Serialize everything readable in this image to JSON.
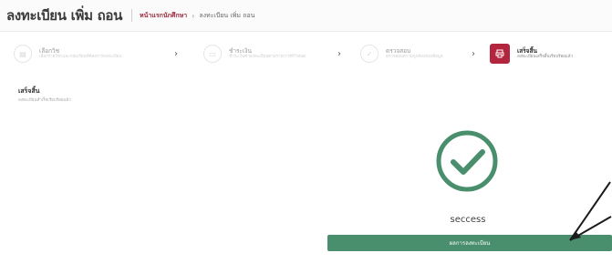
{
  "header": {
    "title": "ลงทะเบียน เพิ่ม ถอน",
    "breadcrumb": {
      "home": "หน้าแรกนักศึกษา",
      "separator": "›",
      "current": "ลงทะเบียน เพิ่ม ถอน"
    }
  },
  "steps": [
    {
      "title": "เลือกวิช",
      "desc": "เลือกรายวิชาและกลุ่มเรียนที่ต้องการลงทะเบียน",
      "icon": "book-icon",
      "active": false
    },
    {
      "title": "ชำระเงิน",
      "desc": "ชำระเงินค่าลงทะเบียนตามรายการที่กำหนด",
      "icon": "wallet-icon",
      "active": false
    },
    {
      "title": "ตรวจสอบ",
      "desc": "ตรวจสอบความถูกต้องของข้อมูล",
      "icon": "check-icon",
      "active": false
    },
    {
      "title": "เสร็จสิ้น",
      "desc": "ลงทะเบียนเสร็จสิ้นเรียบร้อยแล้ว",
      "icon": "print-icon",
      "active": true
    }
  ],
  "step_separator": "›",
  "content": {
    "title": "เสร็จสิ้น",
    "desc": "ลงทะเบียนสำเร็จเรียบร้อยแล้ว"
  },
  "success": {
    "text": "seccess",
    "button_label": "ผลการลงทะเบียน"
  },
  "colors": {
    "accent": "#b3253e",
    "success": "#4a8f6d"
  }
}
